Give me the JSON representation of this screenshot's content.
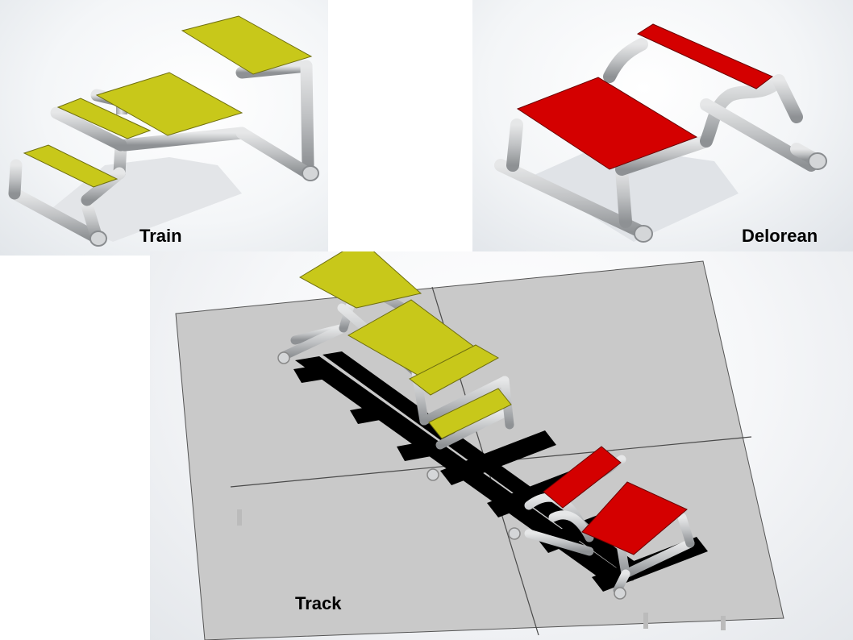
{
  "labels": {
    "train": "Train",
    "delorean": "Delorean",
    "track": "Track"
  },
  "colors": {
    "train_seat": "#c8c81a",
    "delorean_seat": "#d40000",
    "pipe": "#c4c6c8",
    "pipe_shade": "#8f9295",
    "track_surface": "#c9c9c9",
    "track_slats": "#000000"
  }
}
